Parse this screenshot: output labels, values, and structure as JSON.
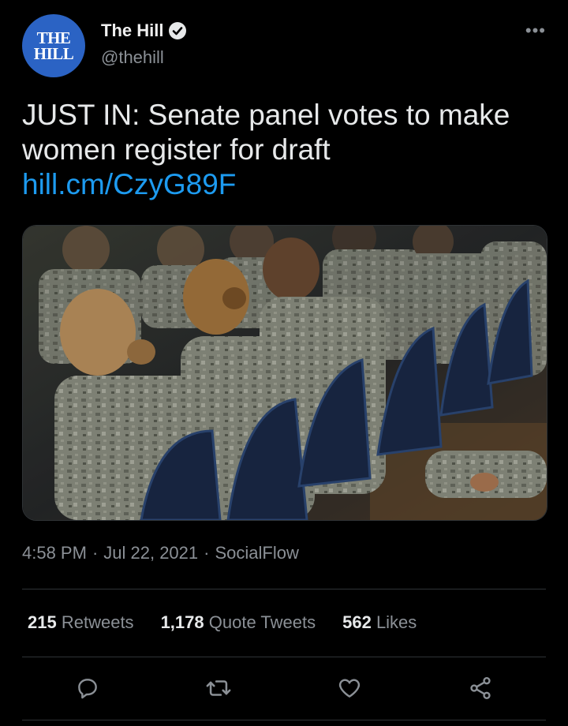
{
  "author": {
    "avatar_line1": "THE",
    "avatar_line2": "HILL",
    "name": "The Hill",
    "handle": "@thehill"
  },
  "more_label": "•••",
  "tweet": {
    "text": "JUST IN: Senate panel votes to make women register for draft",
    "link": "hill.cm/CzyG89F"
  },
  "meta": {
    "time": "4:58 PM",
    "date": "Jul 22, 2021",
    "source": "SocialFlow"
  },
  "stats": [
    {
      "count": "215",
      "label": "Retweets"
    },
    {
      "count": "1,178",
      "label": "Quote Tweets"
    },
    {
      "count": "562",
      "label": "Likes"
    }
  ],
  "actions": [
    "reply-icon",
    "retweet-icon",
    "like-icon",
    "share-icon"
  ],
  "colors": {
    "accent": "#1d9bf0",
    "background": "#000000",
    "avatar": "#2b63c4"
  }
}
